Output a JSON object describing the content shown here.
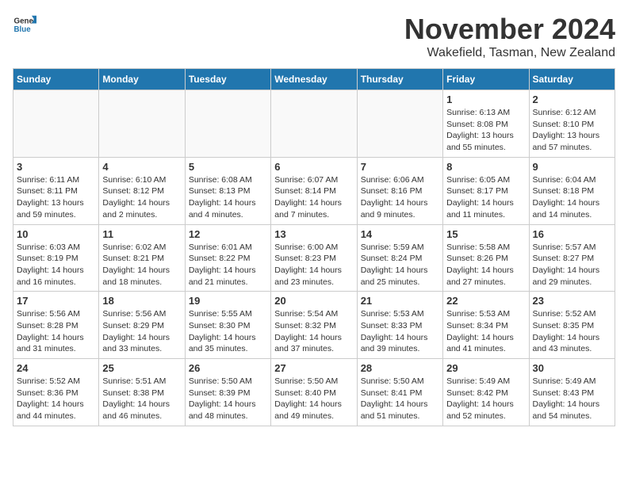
{
  "header": {
    "logo_general": "General",
    "logo_blue": "Blue",
    "month_title": "November 2024",
    "location": "Wakefield, Tasman, New Zealand"
  },
  "weekdays": [
    "Sunday",
    "Monday",
    "Tuesday",
    "Wednesday",
    "Thursday",
    "Friday",
    "Saturday"
  ],
  "weeks": [
    [
      {
        "day": "",
        "info": ""
      },
      {
        "day": "",
        "info": ""
      },
      {
        "day": "",
        "info": ""
      },
      {
        "day": "",
        "info": ""
      },
      {
        "day": "",
        "info": ""
      },
      {
        "day": "1",
        "info": "Sunrise: 6:13 AM\nSunset: 8:08 PM\nDaylight: 13 hours\nand 55 minutes."
      },
      {
        "day": "2",
        "info": "Sunrise: 6:12 AM\nSunset: 8:10 PM\nDaylight: 13 hours\nand 57 minutes."
      }
    ],
    [
      {
        "day": "3",
        "info": "Sunrise: 6:11 AM\nSunset: 8:11 PM\nDaylight: 13 hours\nand 59 minutes."
      },
      {
        "day": "4",
        "info": "Sunrise: 6:10 AM\nSunset: 8:12 PM\nDaylight: 14 hours\nand 2 minutes."
      },
      {
        "day": "5",
        "info": "Sunrise: 6:08 AM\nSunset: 8:13 PM\nDaylight: 14 hours\nand 4 minutes."
      },
      {
        "day": "6",
        "info": "Sunrise: 6:07 AM\nSunset: 8:14 PM\nDaylight: 14 hours\nand 7 minutes."
      },
      {
        "day": "7",
        "info": "Sunrise: 6:06 AM\nSunset: 8:16 PM\nDaylight: 14 hours\nand 9 minutes."
      },
      {
        "day": "8",
        "info": "Sunrise: 6:05 AM\nSunset: 8:17 PM\nDaylight: 14 hours\nand 11 minutes."
      },
      {
        "day": "9",
        "info": "Sunrise: 6:04 AM\nSunset: 8:18 PM\nDaylight: 14 hours\nand 14 minutes."
      }
    ],
    [
      {
        "day": "10",
        "info": "Sunrise: 6:03 AM\nSunset: 8:19 PM\nDaylight: 14 hours\nand 16 minutes."
      },
      {
        "day": "11",
        "info": "Sunrise: 6:02 AM\nSunset: 8:21 PM\nDaylight: 14 hours\nand 18 minutes."
      },
      {
        "day": "12",
        "info": "Sunrise: 6:01 AM\nSunset: 8:22 PM\nDaylight: 14 hours\nand 21 minutes."
      },
      {
        "day": "13",
        "info": "Sunrise: 6:00 AM\nSunset: 8:23 PM\nDaylight: 14 hours\nand 23 minutes."
      },
      {
        "day": "14",
        "info": "Sunrise: 5:59 AM\nSunset: 8:24 PM\nDaylight: 14 hours\nand 25 minutes."
      },
      {
        "day": "15",
        "info": "Sunrise: 5:58 AM\nSunset: 8:26 PM\nDaylight: 14 hours\nand 27 minutes."
      },
      {
        "day": "16",
        "info": "Sunrise: 5:57 AM\nSunset: 8:27 PM\nDaylight: 14 hours\nand 29 minutes."
      }
    ],
    [
      {
        "day": "17",
        "info": "Sunrise: 5:56 AM\nSunset: 8:28 PM\nDaylight: 14 hours\nand 31 minutes."
      },
      {
        "day": "18",
        "info": "Sunrise: 5:56 AM\nSunset: 8:29 PM\nDaylight: 14 hours\nand 33 minutes."
      },
      {
        "day": "19",
        "info": "Sunrise: 5:55 AM\nSunset: 8:30 PM\nDaylight: 14 hours\nand 35 minutes."
      },
      {
        "day": "20",
        "info": "Sunrise: 5:54 AM\nSunset: 8:32 PM\nDaylight: 14 hours\nand 37 minutes."
      },
      {
        "day": "21",
        "info": "Sunrise: 5:53 AM\nSunset: 8:33 PM\nDaylight: 14 hours\nand 39 minutes."
      },
      {
        "day": "22",
        "info": "Sunrise: 5:53 AM\nSunset: 8:34 PM\nDaylight: 14 hours\nand 41 minutes."
      },
      {
        "day": "23",
        "info": "Sunrise: 5:52 AM\nSunset: 8:35 PM\nDaylight: 14 hours\nand 43 minutes."
      }
    ],
    [
      {
        "day": "24",
        "info": "Sunrise: 5:52 AM\nSunset: 8:36 PM\nDaylight: 14 hours\nand 44 minutes."
      },
      {
        "day": "25",
        "info": "Sunrise: 5:51 AM\nSunset: 8:38 PM\nDaylight: 14 hours\nand 46 minutes."
      },
      {
        "day": "26",
        "info": "Sunrise: 5:50 AM\nSunset: 8:39 PM\nDaylight: 14 hours\nand 48 minutes."
      },
      {
        "day": "27",
        "info": "Sunrise: 5:50 AM\nSunset: 8:40 PM\nDaylight: 14 hours\nand 49 minutes."
      },
      {
        "day": "28",
        "info": "Sunrise: 5:50 AM\nSunset: 8:41 PM\nDaylight: 14 hours\nand 51 minutes."
      },
      {
        "day": "29",
        "info": "Sunrise: 5:49 AM\nSunset: 8:42 PM\nDaylight: 14 hours\nand 52 minutes."
      },
      {
        "day": "30",
        "info": "Sunrise: 5:49 AM\nSunset: 8:43 PM\nDaylight: 14 hours\nand 54 minutes."
      }
    ]
  ]
}
